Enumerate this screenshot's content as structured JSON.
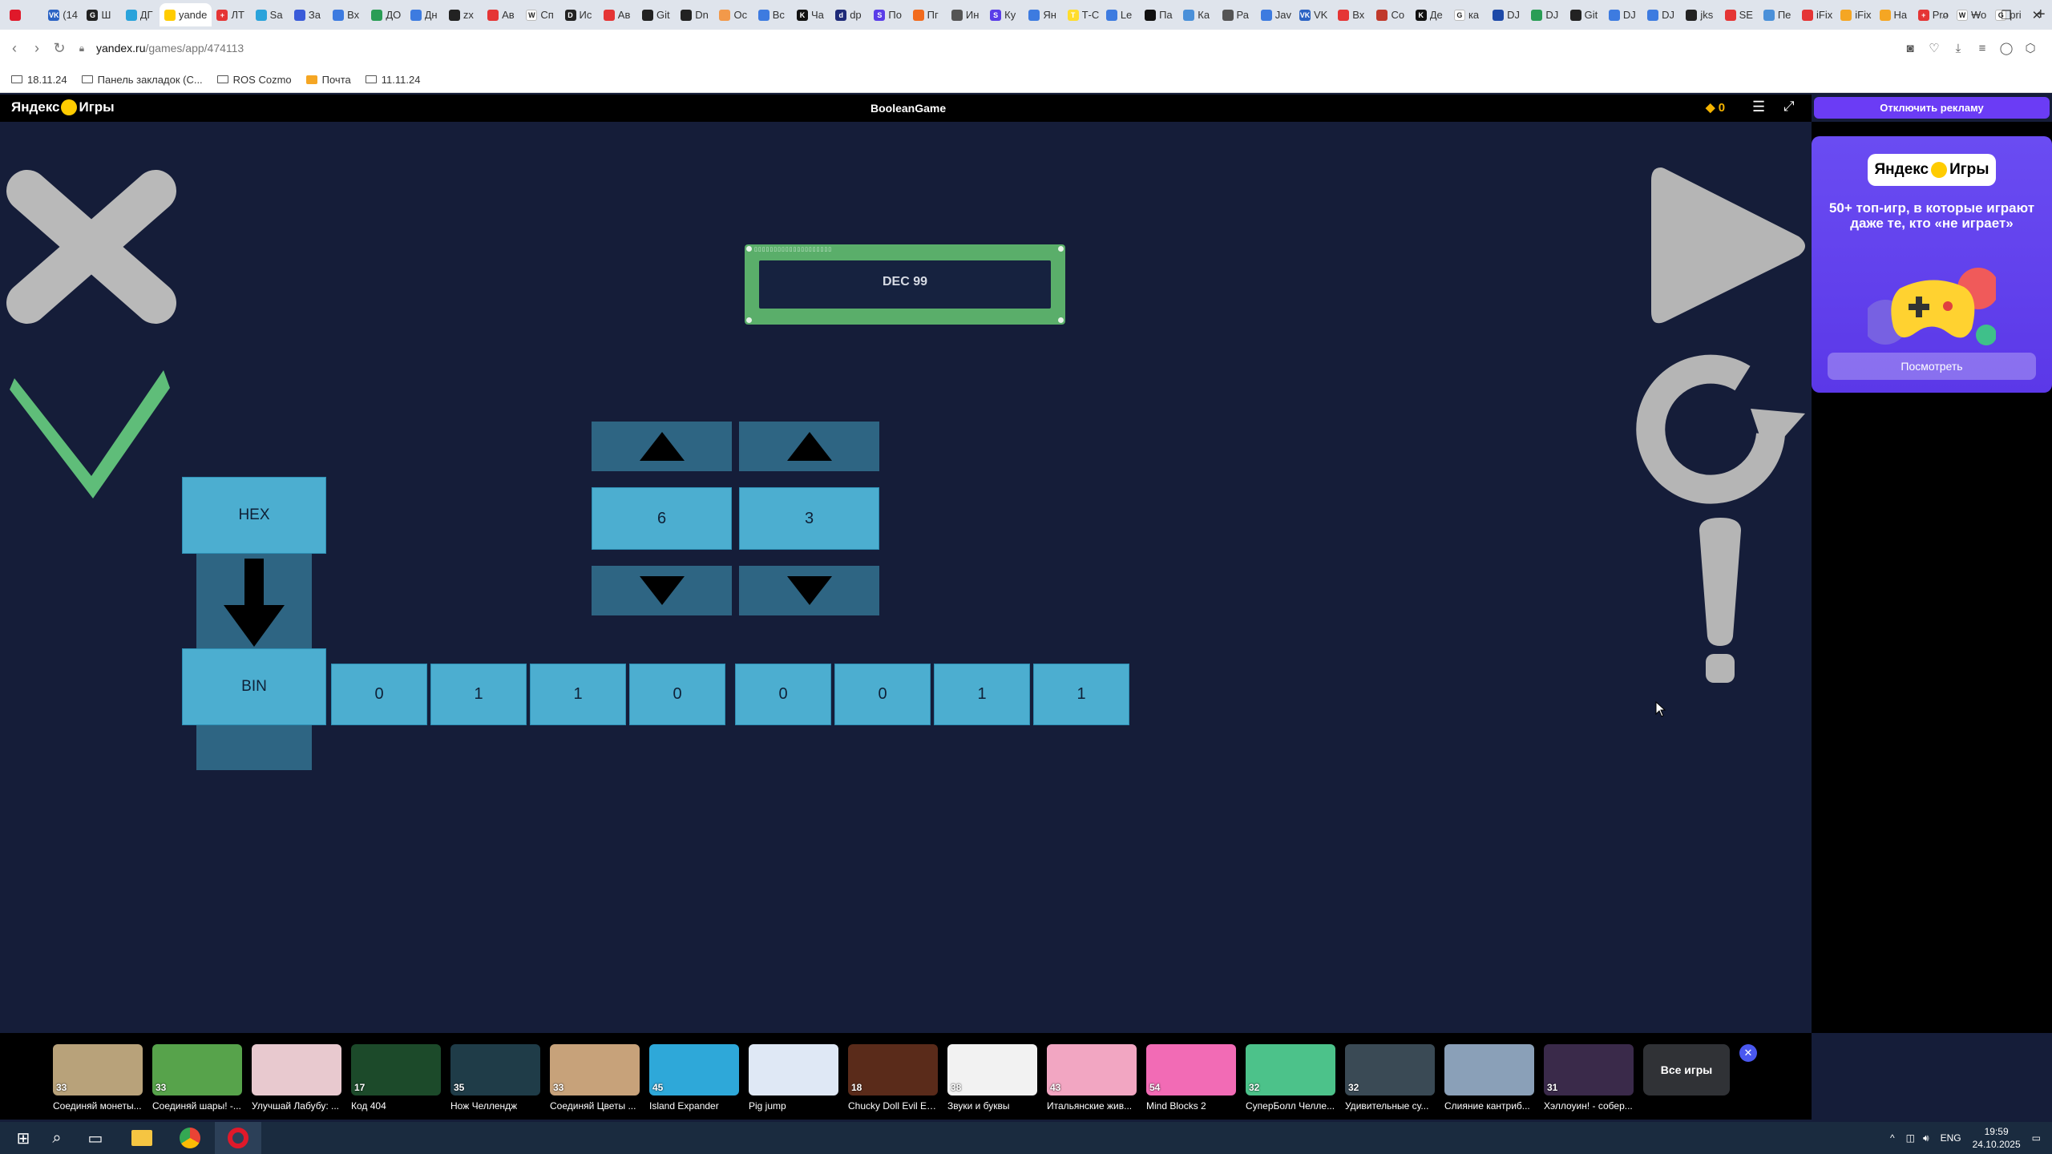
{
  "browser": {
    "tabs": [
      {
        "label": "",
        "icon": "opera-icon",
        "color": "#e0192a",
        "glyph": ""
      },
      {
        "label": "(14",
        "icon": "vk-icon",
        "color": "#2b63c4",
        "glyph": "VK"
      },
      {
        "label": "Ш",
        "icon": "github-icon",
        "color": "#222222",
        "glyph": "G"
      },
      {
        "label": "ДГ",
        "icon": "telegram-icon",
        "color": "#2aa3db",
        "glyph": ""
      },
      {
        "label": "yande",
        "icon": "yandex-games-icon",
        "color": "#ffcc00",
        "glyph": ""
      },
      {
        "label": "ЛТ",
        "icon": "red-plus-icon",
        "color": "#e53535",
        "glyph": "+"
      },
      {
        "label": "Sa",
        "icon": "telegram-icon",
        "color": "#2aa3db",
        "glyph": ""
      },
      {
        "label": "За",
        "icon": "docs-icon",
        "color": "#3a5bd9",
        "glyph": ""
      },
      {
        "label": "Вх",
        "icon": "mail-icon",
        "color": "#3d7be0",
        "glyph": ""
      },
      {
        "label": "ДО",
        "icon": "drive-icon",
        "color": "#2a9d55",
        "glyph": ""
      },
      {
        "label": "Дн",
        "icon": "cloud-icon",
        "color": "#3d7be0",
        "glyph": ""
      },
      {
        "label": "zx",
        "icon": "github-icon",
        "color": "#222222",
        "glyph": ""
      },
      {
        "label": "Ав",
        "icon": "red-circle-icon",
        "color": "#e53535",
        "glyph": ""
      },
      {
        "label": "Сп",
        "icon": "wiki-icon",
        "color": "#ffffff",
        "glyph": "W"
      },
      {
        "label": "Ис",
        "icon": "dark-square-icon",
        "color": "#222222",
        "glyph": "D"
      },
      {
        "label": "Ав",
        "icon": "red-circle-icon",
        "color": "#e53535",
        "glyph": ""
      },
      {
        "label": "Git",
        "icon": "github-icon",
        "color": "#222222",
        "glyph": ""
      },
      {
        "label": "Dn",
        "icon": "github-icon",
        "color": "#222222",
        "glyph": ""
      },
      {
        "label": "Ос",
        "icon": "colorful-icon",
        "color": "#f2994a",
        "glyph": ""
      },
      {
        "label": "Вс",
        "icon": "blue-square-icon",
        "color": "#3d7be0",
        "glyph": ""
      },
      {
        "label": "Чa",
        "icon": "k-icon",
        "color": "#111111",
        "glyph": "K"
      },
      {
        "label": "dp",
        "icon": "dp-icon",
        "color": "#1e2a78",
        "glyph": "d"
      },
      {
        "label": "По",
        "icon": "s-icon",
        "color": "#5a3de8",
        "glyph": "S"
      },
      {
        "label": "Пг",
        "icon": "orange-icon",
        "color": "#f26b1d",
        "glyph": ""
      },
      {
        "label": "Ин",
        "icon": "doc-icon",
        "color": "#555555",
        "glyph": ""
      },
      {
        "label": "Ку",
        "icon": "s-icon",
        "color": "#5a3de8",
        "glyph": "S"
      },
      {
        "label": "Ян",
        "icon": "cloud-icon",
        "color": "#3d7be0",
        "glyph": ""
      },
      {
        "label": "Т-С",
        "icon": "t-icon",
        "color": "#ffdd2d",
        "glyph": "T"
      },
      {
        "label": "Le",
        "icon": "le-icon",
        "color": "#3d7be0",
        "glyph": ""
      },
      {
        "label": "Па",
        "icon": "black-icon",
        "color": "#111111",
        "glyph": ""
      },
      {
        "label": "Ка",
        "icon": "blue-icon",
        "color": "#4a90d9",
        "glyph": ""
      },
      {
        "label": "Ра",
        "icon": "doc-icon",
        "color": "#555555",
        "glyph": ""
      },
      {
        "label": "Jav",
        "icon": "cloud-icon",
        "color": "#3d7be0",
        "glyph": ""
      },
      {
        "label": "VK",
        "icon": "vk-icon",
        "color": "#2b63c4",
        "glyph": "VK"
      },
      {
        "label": "Вх",
        "icon": "mail-icon",
        "color": "#e53535",
        "glyph": ""
      },
      {
        "label": "Со",
        "icon": "flag-icon",
        "color": "#c0392b",
        "glyph": ""
      },
      {
        "label": "Де",
        "icon": "k-icon",
        "color": "#111111",
        "glyph": "K"
      },
      {
        "label": "ка",
        "icon": "google-icon",
        "color": "#ffffff",
        "glyph": "G"
      },
      {
        "label": "DJ",
        "icon": "dj-icon",
        "color": "#1e4aa8",
        "glyph": ""
      },
      {
        "label": "DJ",
        "icon": "drive-icon",
        "color": "#2a9d55",
        "glyph": ""
      },
      {
        "label": "Git",
        "icon": "github-icon",
        "color": "#222222",
        "glyph": ""
      },
      {
        "label": "DJ",
        "icon": "cloud-icon",
        "color": "#3d7be0",
        "glyph": ""
      },
      {
        "label": "DJ",
        "icon": "cloud-icon",
        "color": "#3d7be0",
        "glyph": ""
      },
      {
        "label": "jks",
        "icon": "github-icon",
        "color": "#222222",
        "glyph": ""
      },
      {
        "label": "SE",
        "icon": "se-icon",
        "color": "#e53535",
        "glyph": ""
      },
      {
        "label": "Пе",
        "icon": "translate-icon",
        "color": "#4a90d9",
        "glyph": ""
      },
      {
        "label": "iFix",
        "icon": "red-circle-icon",
        "color": "#e53535",
        "glyph": ""
      },
      {
        "label": "iFix",
        "icon": "flag-icon",
        "color": "#f5a623",
        "glyph": ""
      },
      {
        "label": "На",
        "icon": "orange-circle-icon",
        "color": "#f5a623",
        "glyph": ""
      },
      {
        "label": "Pro",
        "icon": "red-plus-icon",
        "color": "#e53535",
        "glyph": "+"
      },
      {
        "label": "Wo",
        "icon": "wiki-icon",
        "color": "#ffffff",
        "glyph": "W"
      },
      {
        "label": "pri",
        "icon": "google-icon",
        "color": "#ffffff",
        "glyph": "G"
      }
    ],
    "active_tab_index": 4,
    "url_host": "yandex.ru",
    "url_path": "/games/app/474113",
    "bookmarks": [
      {
        "label": "18.11.24",
        "icon": "folder-icon"
      },
      {
        "label": "Панель закладок (С...",
        "icon": "folder-icon"
      },
      {
        "label": "ROS Cozmo",
        "icon": "folder-icon"
      },
      {
        "label": "Почта",
        "icon": "mail-icon"
      },
      {
        "label": "11.11.24",
        "icon": "folder-icon"
      }
    ]
  },
  "header": {
    "logo": "Яндекс",
    "logo_suffix": "Игры",
    "game_title": "BooleanGame",
    "coins": "0",
    "disable_ads_label": "Отключить рекламу"
  },
  "promo": {
    "logo": "Яндекс",
    "logo_suffix": "Игры",
    "text": "50+ топ-игр, в которые играют даже те, кто «не играет»",
    "button": "Посмотреть"
  },
  "game": {
    "display_text": "DEC 99",
    "hex_label": "HEX",
    "bin_label": "BIN",
    "hex_digits": [
      "6",
      "3"
    ],
    "bits": [
      "0",
      "1",
      "1",
      "0",
      "0",
      "0",
      "1",
      "1"
    ],
    "colors": {
      "background": "#151d39",
      "cell": "#4caed0",
      "arrow_button": "#2e6583",
      "wrong": "#b9b9b9",
      "correct": "#5fbd79",
      "lcd_frame": "#5aae6a",
      "control": "#b5b5b5"
    }
  },
  "bottom_games": [
    {
      "name": "Соединяй монеты...",
      "rating": "33",
      "color": "#b8a27a"
    },
    {
      "name": "Соединяй шары! -...",
      "rating": "33",
      "color": "#57a34b"
    },
    {
      "name": "Улучшай Лабубу: ...",
      "rating": "",
      "color": "#e8c9cf"
    },
    {
      "name": "Код 404",
      "rating": "17",
      "color": "#1c4a2a"
    },
    {
      "name": "Нож Челлендж",
      "rating": "35",
      "color": "#1f3c48"
    },
    {
      "name": "Соединяй Цветы ...",
      "rating": "33",
      "color": "#c7a27a"
    },
    {
      "name": "Island Expander",
      "rating": "45",
      "color": "#2ea8d9"
    },
    {
      "name": "Pig jump",
      "rating": "",
      "color": "#dfe8f5"
    },
    {
      "name": "Chucky Doll Evil Es...",
      "rating": "18",
      "color": "#5a2b1a"
    },
    {
      "name": "Звуки и буквы",
      "rating": "38",
      "color": "#f2f2f2"
    },
    {
      "name": "Итальянские жив...",
      "rating": "43",
      "color": "#f2a6c2"
    },
    {
      "name": "Mind Blocks 2",
      "rating": "54",
      "color": "#f26bb5"
    },
    {
      "name": "СуперБолл Челле...",
      "rating": "32",
      "color": "#4cc28a"
    },
    {
      "name": "Удивительные су...",
      "rating": "32",
      "color": "#3a4a55"
    },
    {
      "name": "Слияние кантриб...",
      "rating": "",
      "color": "#8aa0b8"
    },
    {
      "name": "Хэллоуин! - собер...",
      "rating": "31",
      "color": "#3a2a4a"
    }
  ],
  "all_games_label": "Все игры",
  "taskbar": {
    "time": "19:59",
    "date": "24.10.2025",
    "lang": "ENG"
  }
}
